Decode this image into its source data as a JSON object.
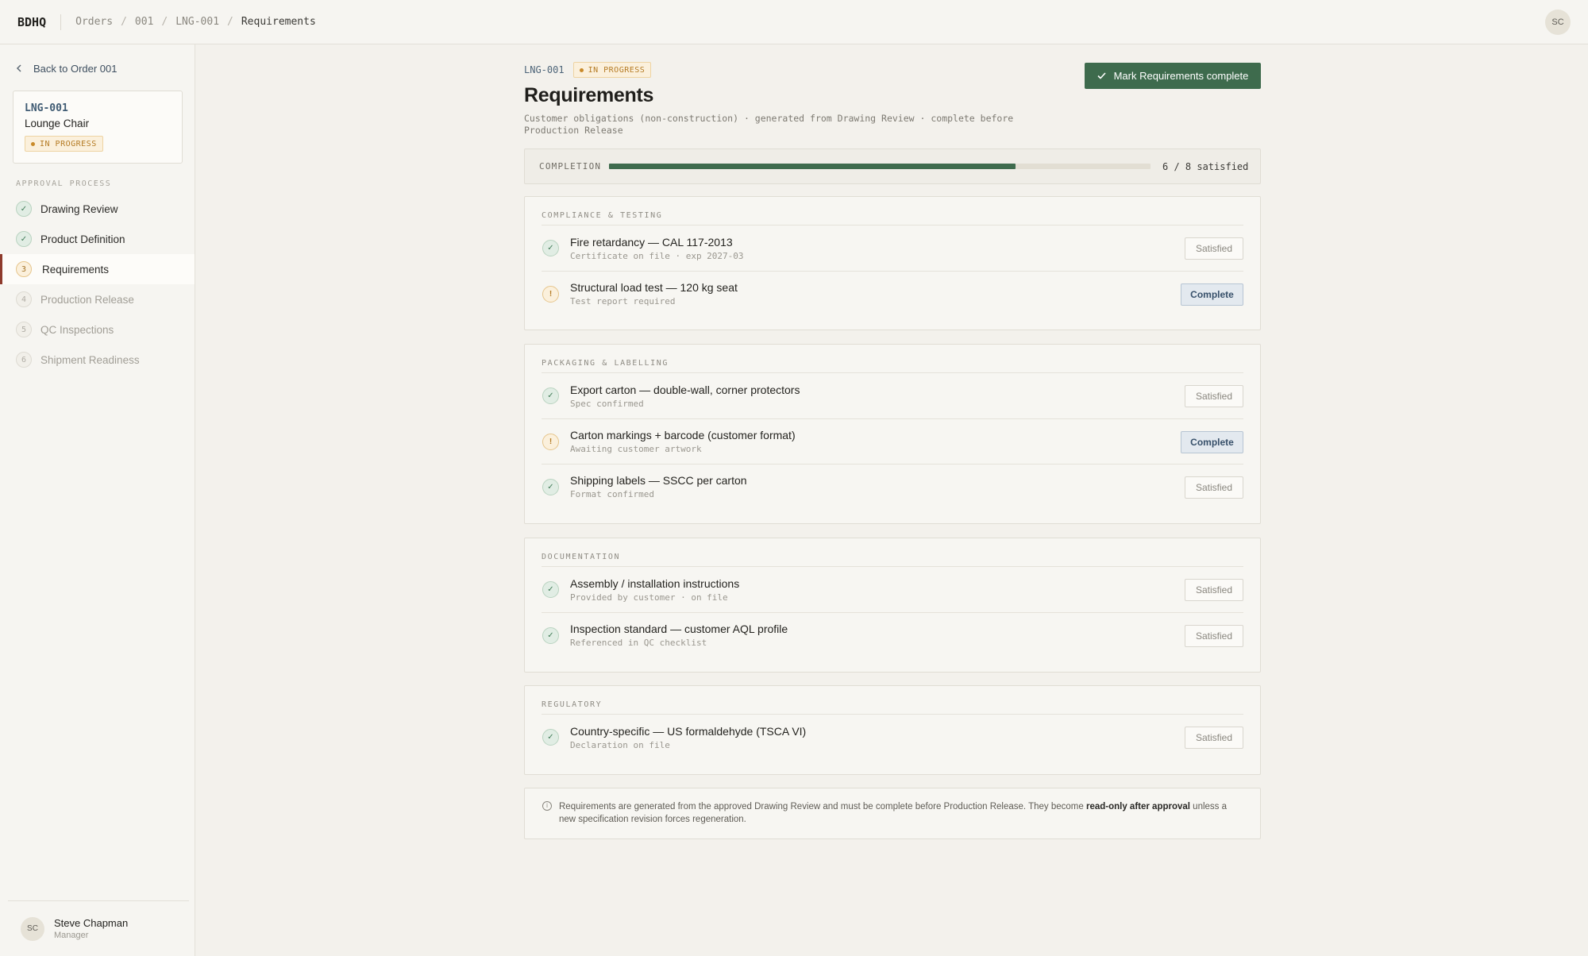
{
  "topbar": {
    "brand": "BDHQ",
    "breadcrumbs": [
      "Orders",
      "001",
      "LNG-001",
      "Requirements"
    ],
    "separator": "/",
    "avatar_initials": "SC"
  },
  "sidebar": {
    "back_label": "Back to Order 001",
    "item": {
      "code": "LNG-001",
      "name": "Lounge Chair",
      "status": "IN PROGRESS"
    },
    "section_label": "APPROVAL PROCESS",
    "steps": [
      {
        "num": "✓",
        "label": "Drawing Review",
        "state": "done"
      },
      {
        "num": "✓",
        "label": "Product Definition",
        "state": "done"
      },
      {
        "num": "3",
        "label": "Requirements",
        "state": "active"
      },
      {
        "num": "4",
        "label": "Production Release",
        "state": "todo"
      },
      {
        "num": "5",
        "label": "QC Inspections",
        "state": "todo"
      },
      {
        "num": "6",
        "label": "Shipment Readiness",
        "state": "todo"
      }
    ],
    "user": {
      "initials": "SC",
      "name": "Steve Chapman",
      "role": "Manager"
    }
  },
  "header": {
    "code": "LNG-001",
    "status": "IN PROGRESS",
    "title": "Requirements",
    "subtitle": "Customer obligations (non-construction) · generated from Drawing Review · complete before Production Release",
    "primary_action": "Mark Requirements complete"
  },
  "completion": {
    "label": "COMPLETION",
    "satisfied": 6,
    "total": 8,
    "summary": "6 / 8 satisfied"
  },
  "groups": [
    {
      "title": "COMPLIANCE & TESTING",
      "items": [
        {
          "title": "Fire retardancy — CAL 117-2013",
          "subtitle": "Certificate on file · exp 2027-03",
          "status": "ok",
          "action": "Satisfied"
        },
        {
          "title": "Structural load test — 120 kg seat",
          "subtitle": "Test report required",
          "status": "warn",
          "action": "Complete"
        }
      ]
    },
    {
      "title": "PACKAGING & LABELLING",
      "items": [
        {
          "title": "Export carton — double-wall, corner protectors",
          "subtitle": "Spec confirmed",
          "status": "ok",
          "action": "Satisfied"
        },
        {
          "title": "Carton markings + barcode (customer format)",
          "subtitle": "Awaiting customer artwork",
          "status": "warn",
          "action": "Complete"
        },
        {
          "title": "Shipping labels — SSCC per carton",
          "subtitle": "Format confirmed",
          "status": "ok",
          "action": "Satisfied"
        }
      ]
    },
    {
      "title": "DOCUMENTATION",
      "items": [
        {
          "title": "Assembly / installation instructions",
          "subtitle": "Provided by customer · on file",
          "status": "ok",
          "action": "Satisfied"
        },
        {
          "title": "Inspection standard — customer AQL profile",
          "subtitle": "Referenced in QC checklist",
          "status": "ok",
          "action": "Satisfied"
        }
      ]
    },
    {
      "title": "REGULATORY",
      "items": [
        {
          "title": "Country-specific — US formaldehyde (TSCA VI)",
          "subtitle": "Declaration on file",
          "status": "ok",
          "action": "Satisfied"
        }
      ]
    }
  ],
  "note": {
    "before": "Requirements are generated from the approved Drawing Review and must be complete before Production Release. They become ",
    "bold": "read-only after approval",
    "after": " unless a new specification revision forces regeneration."
  },
  "icons": {
    "check": "check-icon",
    "warning": "exclamation-icon",
    "back": "chevron-left-icon",
    "info": "info-icon"
  },
  "colors": {
    "accent_green": "#3e6b4d",
    "progress_status": "#b57b24",
    "active_marker": "#8e3b2c",
    "complete_button": "#37506a"
  }
}
